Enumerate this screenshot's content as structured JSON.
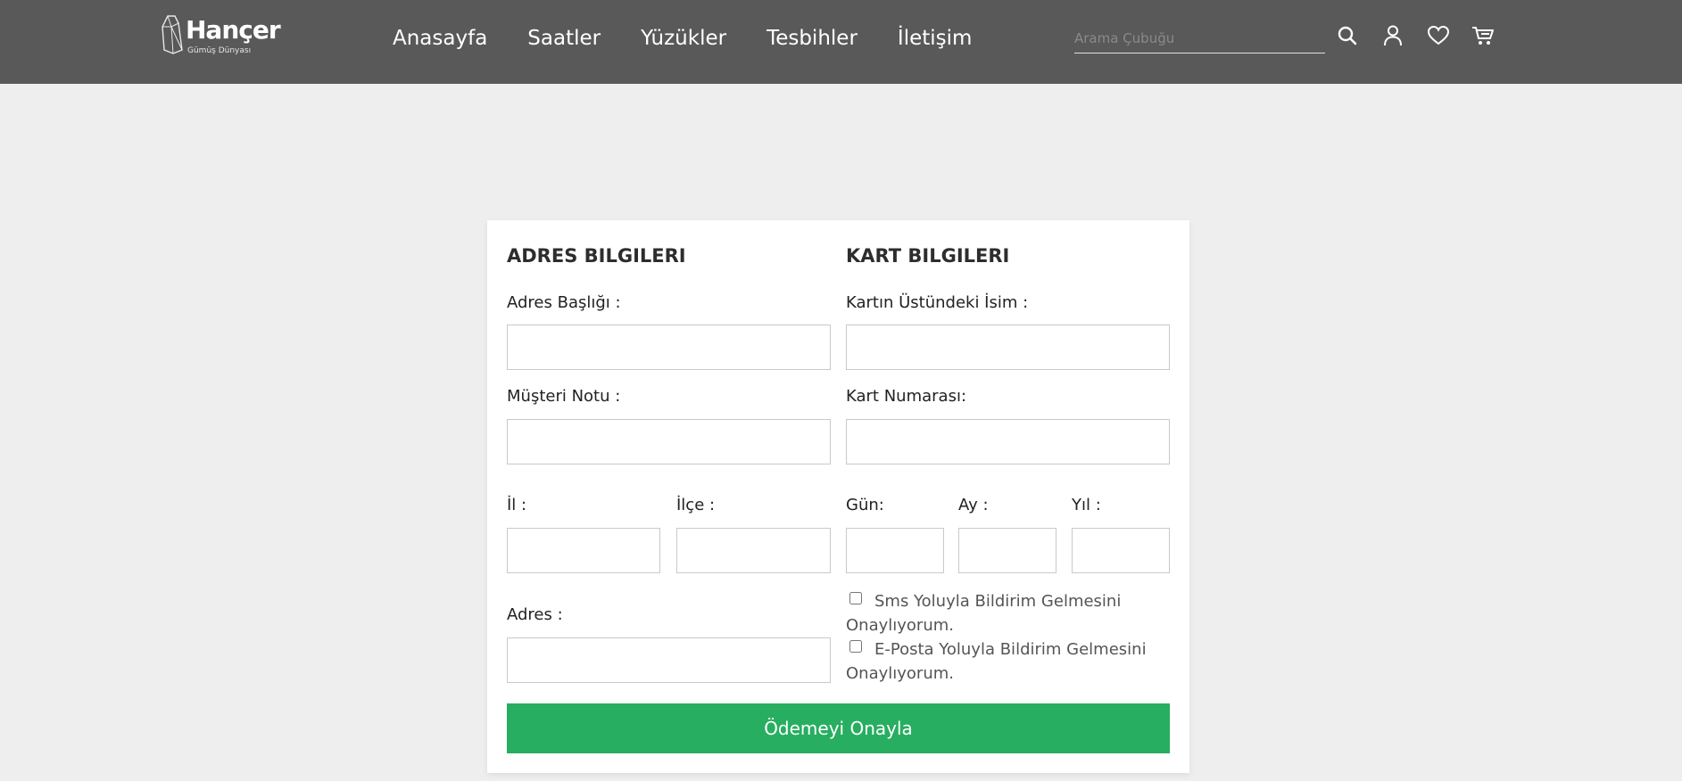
{
  "header": {
    "logo": {
      "title": "Hançer",
      "subtitle": "Gümüş Dünyası"
    },
    "nav": [
      "Anasayfa",
      "Saatler",
      "Yüzükler",
      "Tesbihler",
      "İletişim"
    ],
    "search": {
      "placeholder": "Arama Çubuğu",
      "value": ""
    },
    "icons": [
      "search-icon",
      "user-icon",
      "heart-icon",
      "cart-icon"
    ],
    "background_color": "#595959"
  },
  "address": {
    "title": "ADRES BILGILERI",
    "address_title_label": "Adres Başlığı :",
    "customer_note_label": "Müşteri Notu :",
    "city_label": "İl :",
    "district_label": "İlçe :",
    "address_label": "Adres :"
  },
  "card": {
    "title": "KART BILGILERI",
    "name_label": "Kartın Üstündeki İsim :",
    "number_label": "Kart Numarası:",
    "day_label": "Gün:",
    "month_label": "Ay :",
    "year_label": "Yıl :"
  },
  "consents": {
    "sms": "Sms Yoluyla Bildirim Gelmesini Onaylıyorum.",
    "email": "E-Posta Yoluyla Bildirim Gelmesini Onaylıyorum."
  },
  "submit": {
    "label": "Ödemeyi Onayla",
    "color": "#27ae60"
  }
}
